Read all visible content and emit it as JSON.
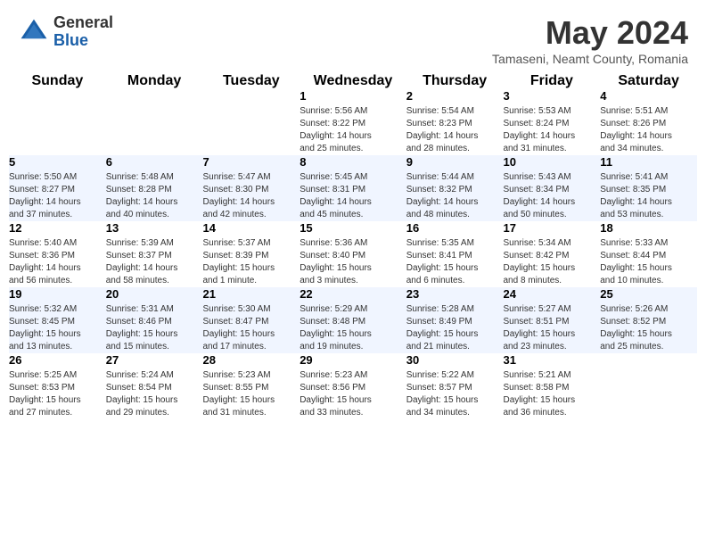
{
  "header": {
    "logo_general": "General",
    "logo_blue": "Blue",
    "month_title": "May 2024",
    "subtitle": "Tamaseni, Neamt County, Romania"
  },
  "weekdays": [
    "Sunday",
    "Monday",
    "Tuesday",
    "Wednesday",
    "Thursday",
    "Friday",
    "Saturday"
  ],
  "weeks": [
    [
      {
        "day": "",
        "info": ""
      },
      {
        "day": "",
        "info": ""
      },
      {
        "day": "",
        "info": ""
      },
      {
        "day": "1",
        "info": "Sunrise: 5:56 AM\nSunset: 8:22 PM\nDaylight: 14 hours\nand 25 minutes."
      },
      {
        "day": "2",
        "info": "Sunrise: 5:54 AM\nSunset: 8:23 PM\nDaylight: 14 hours\nand 28 minutes."
      },
      {
        "day": "3",
        "info": "Sunrise: 5:53 AM\nSunset: 8:24 PM\nDaylight: 14 hours\nand 31 minutes."
      },
      {
        "day": "4",
        "info": "Sunrise: 5:51 AM\nSunset: 8:26 PM\nDaylight: 14 hours\nand 34 minutes."
      }
    ],
    [
      {
        "day": "5",
        "info": "Sunrise: 5:50 AM\nSunset: 8:27 PM\nDaylight: 14 hours\nand 37 minutes."
      },
      {
        "day": "6",
        "info": "Sunrise: 5:48 AM\nSunset: 8:28 PM\nDaylight: 14 hours\nand 40 minutes."
      },
      {
        "day": "7",
        "info": "Sunrise: 5:47 AM\nSunset: 8:30 PM\nDaylight: 14 hours\nand 42 minutes."
      },
      {
        "day": "8",
        "info": "Sunrise: 5:45 AM\nSunset: 8:31 PM\nDaylight: 14 hours\nand 45 minutes."
      },
      {
        "day": "9",
        "info": "Sunrise: 5:44 AM\nSunset: 8:32 PM\nDaylight: 14 hours\nand 48 minutes."
      },
      {
        "day": "10",
        "info": "Sunrise: 5:43 AM\nSunset: 8:34 PM\nDaylight: 14 hours\nand 50 minutes."
      },
      {
        "day": "11",
        "info": "Sunrise: 5:41 AM\nSunset: 8:35 PM\nDaylight: 14 hours\nand 53 minutes."
      }
    ],
    [
      {
        "day": "12",
        "info": "Sunrise: 5:40 AM\nSunset: 8:36 PM\nDaylight: 14 hours\nand 56 minutes."
      },
      {
        "day": "13",
        "info": "Sunrise: 5:39 AM\nSunset: 8:37 PM\nDaylight: 14 hours\nand 58 minutes."
      },
      {
        "day": "14",
        "info": "Sunrise: 5:37 AM\nSunset: 8:39 PM\nDaylight: 15 hours\nand 1 minute."
      },
      {
        "day": "15",
        "info": "Sunrise: 5:36 AM\nSunset: 8:40 PM\nDaylight: 15 hours\nand 3 minutes."
      },
      {
        "day": "16",
        "info": "Sunrise: 5:35 AM\nSunset: 8:41 PM\nDaylight: 15 hours\nand 6 minutes."
      },
      {
        "day": "17",
        "info": "Sunrise: 5:34 AM\nSunset: 8:42 PM\nDaylight: 15 hours\nand 8 minutes."
      },
      {
        "day": "18",
        "info": "Sunrise: 5:33 AM\nSunset: 8:44 PM\nDaylight: 15 hours\nand 10 minutes."
      }
    ],
    [
      {
        "day": "19",
        "info": "Sunrise: 5:32 AM\nSunset: 8:45 PM\nDaylight: 15 hours\nand 13 minutes."
      },
      {
        "day": "20",
        "info": "Sunrise: 5:31 AM\nSunset: 8:46 PM\nDaylight: 15 hours\nand 15 minutes."
      },
      {
        "day": "21",
        "info": "Sunrise: 5:30 AM\nSunset: 8:47 PM\nDaylight: 15 hours\nand 17 minutes."
      },
      {
        "day": "22",
        "info": "Sunrise: 5:29 AM\nSunset: 8:48 PM\nDaylight: 15 hours\nand 19 minutes."
      },
      {
        "day": "23",
        "info": "Sunrise: 5:28 AM\nSunset: 8:49 PM\nDaylight: 15 hours\nand 21 minutes."
      },
      {
        "day": "24",
        "info": "Sunrise: 5:27 AM\nSunset: 8:51 PM\nDaylight: 15 hours\nand 23 minutes."
      },
      {
        "day": "25",
        "info": "Sunrise: 5:26 AM\nSunset: 8:52 PM\nDaylight: 15 hours\nand 25 minutes."
      }
    ],
    [
      {
        "day": "26",
        "info": "Sunrise: 5:25 AM\nSunset: 8:53 PM\nDaylight: 15 hours\nand 27 minutes."
      },
      {
        "day": "27",
        "info": "Sunrise: 5:24 AM\nSunset: 8:54 PM\nDaylight: 15 hours\nand 29 minutes."
      },
      {
        "day": "28",
        "info": "Sunrise: 5:23 AM\nSunset: 8:55 PM\nDaylight: 15 hours\nand 31 minutes."
      },
      {
        "day": "29",
        "info": "Sunrise: 5:23 AM\nSunset: 8:56 PM\nDaylight: 15 hours\nand 33 minutes."
      },
      {
        "day": "30",
        "info": "Sunrise: 5:22 AM\nSunset: 8:57 PM\nDaylight: 15 hours\nand 34 minutes."
      },
      {
        "day": "31",
        "info": "Sunrise: 5:21 AM\nSunset: 8:58 PM\nDaylight: 15 hours\nand 36 minutes."
      },
      {
        "day": "",
        "info": ""
      }
    ]
  ]
}
